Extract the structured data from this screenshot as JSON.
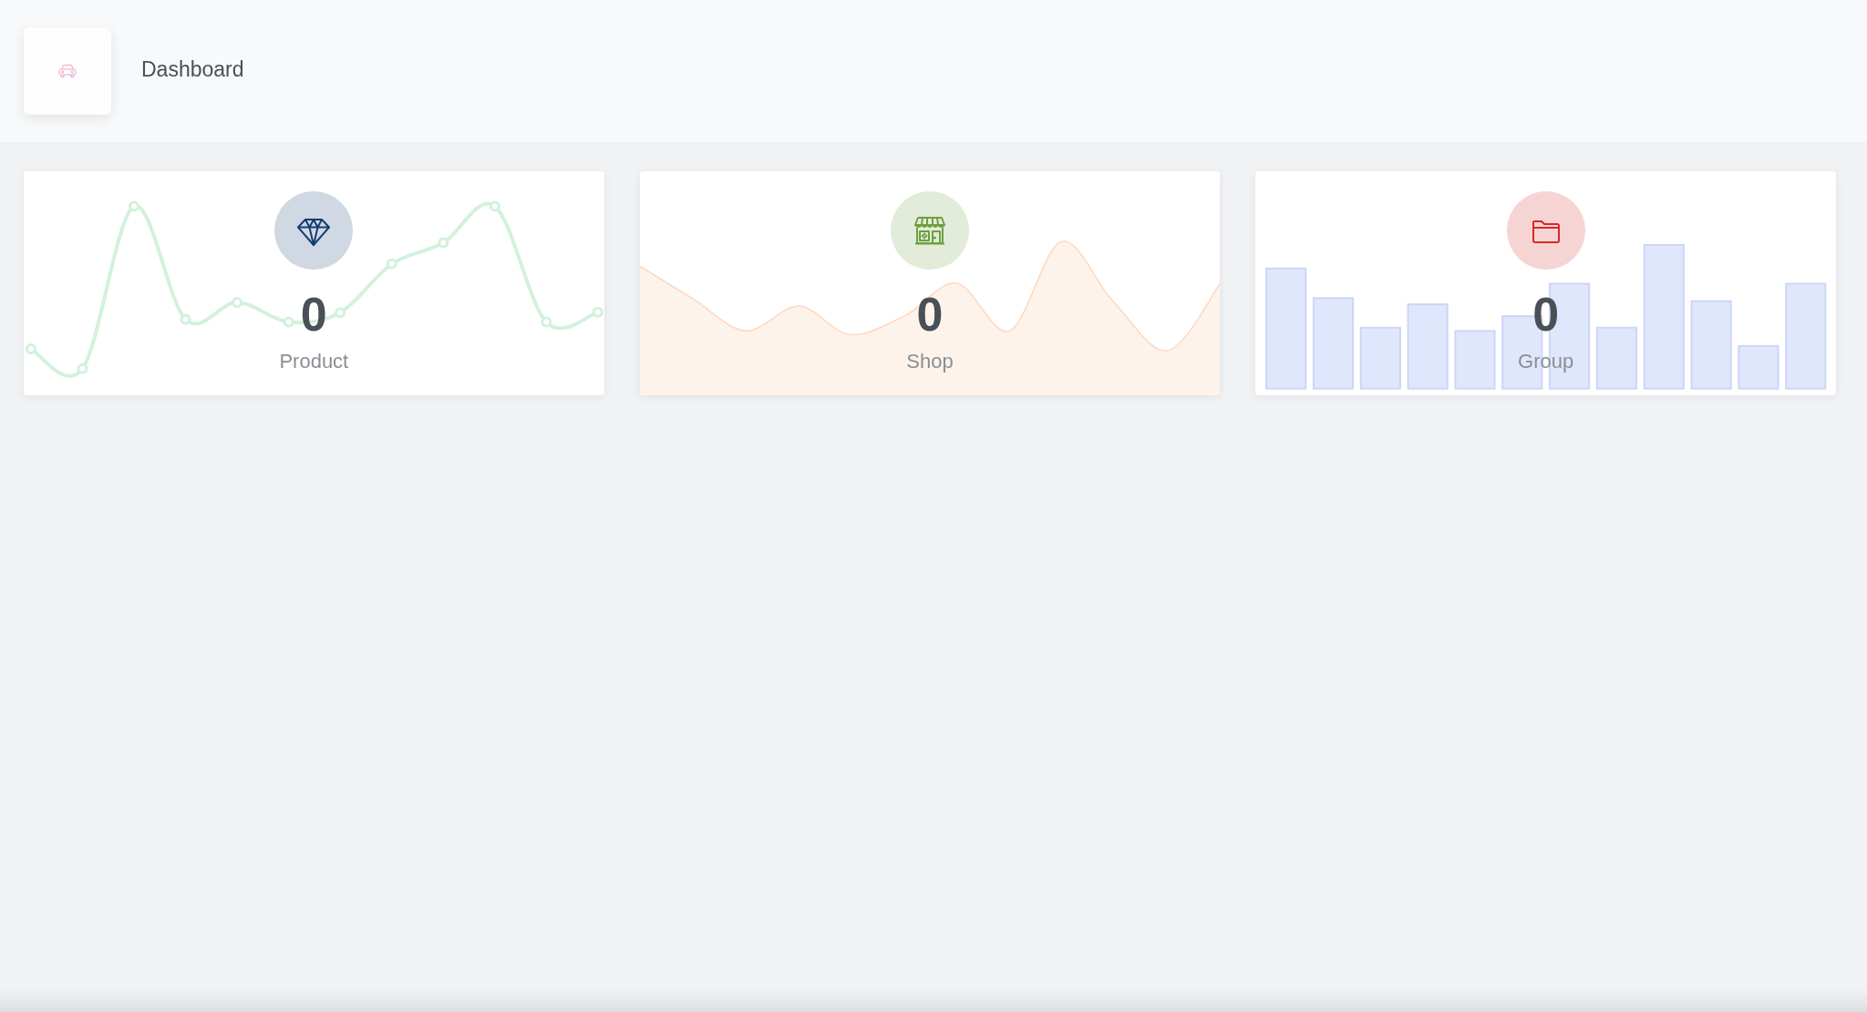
{
  "header": {
    "title": "Dashboard"
  },
  "stats": [
    {
      "kind": "line",
      "value": "0",
      "label": "Product",
      "color": "#d0d8e3"
    },
    {
      "kind": "area",
      "value": "0",
      "label": "Shop",
      "color": "#e2ecd9"
    },
    {
      "kind": "bar",
      "value": "0",
      "label": "Group",
      "color": "#f7d4d4"
    }
  ]
}
